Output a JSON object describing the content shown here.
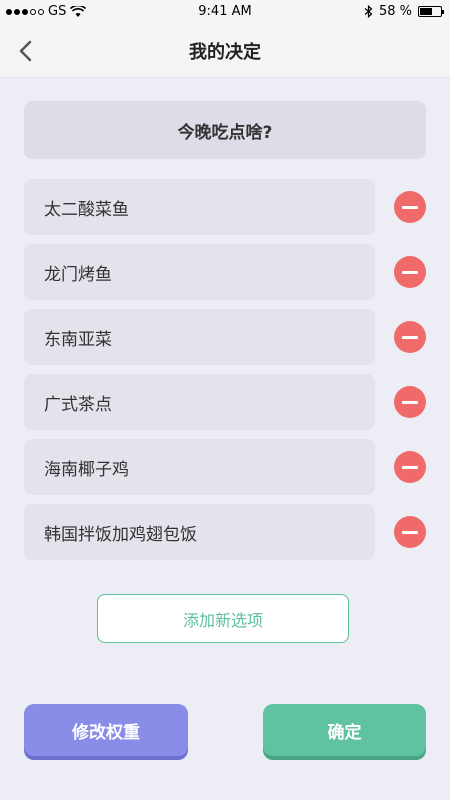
{
  "status_bar": {
    "carrier": "GS",
    "time": "9:41 AM",
    "battery": "58 %",
    "battery_level": 0.58,
    "signal_bars_filled": 3,
    "signal_bars_total": 5
  },
  "nav": {
    "title": "我的决定",
    "back_icon": "chevron-left-icon"
  },
  "question": "今晚吃点啥?",
  "options": [
    {
      "label": "太二酸菜鱼"
    },
    {
      "label": "龙门烤鱼"
    },
    {
      "label": "东南亚菜"
    },
    {
      "label": "广式茶点"
    },
    {
      "label": "海南椰子鸡"
    },
    {
      "label": "韩国拌饭加鸡翅包饭"
    }
  ],
  "add_option_label": "添加新选项",
  "footer": {
    "edit_weight_label": "修改权重",
    "confirm_label": "确定"
  },
  "colors": {
    "remove": "#F06A6A",
    "accent_green": "#5FC2A2",
    "accent_purple": "#8A8DE8"
  }
}
